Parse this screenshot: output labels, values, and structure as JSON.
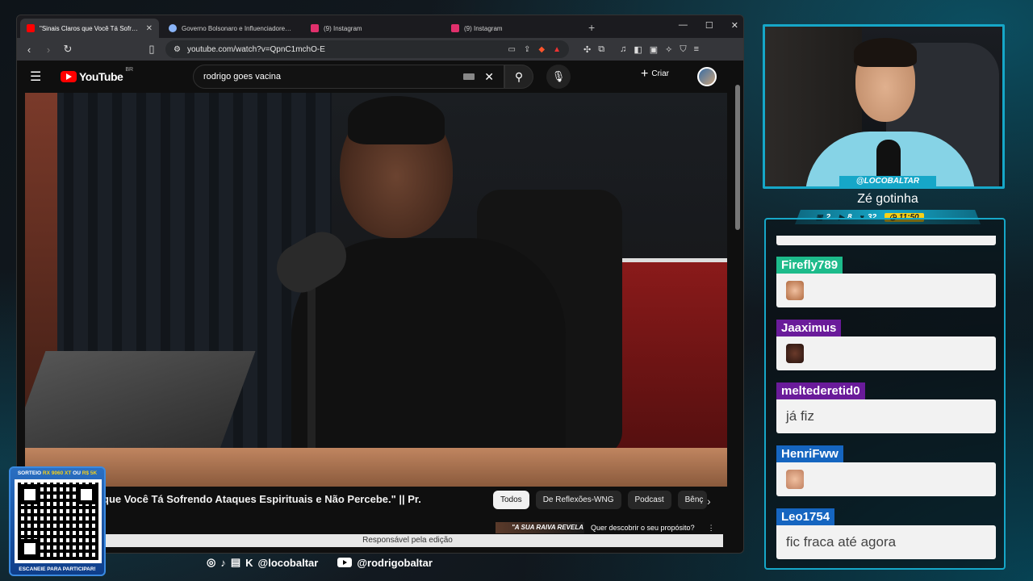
{
  "browser": {
    "tabs": [
      {
        "title": "\"Sinais Claros que Você Tá Sofrendo",
        "fav_color": "#ff0000",
        "active": true
      },
      {
        "title": "Governo Bolsonaro e Influenciadores Pagos",
        "fav_color": "#8ab4f8",
        "active": false
      },
      {
        "title": "(9) Instagram",
        "fav_color": "#e1306c",
        "active": false
      },
      {
        "title": "(9) Instagram",
        "fav_color": "#e1306c",
        "active": false
      }
    ],
    "url": "youtube.com/watch?v=QpnC1mchO-E"
  },
  "youtube": {
    "logo": "YouTube",
    "country": "BR",
    "search_value": "rodrigo goes vacina",
    "create_label": "Criar",
    "video_title": "que Você Tá Sofrendo Ataques Espirituais e Não Percebe.\" || Pr.",
    "chips": [
      "Todos",
      "De Reflexões-WNG",
      "Podcast",
      "Bênç"
    ],
    "rec_thumb_text": "\"A SUA RAIVA REVELA",
    "rec_title": "Quer descobrir o seu propósito?",
    "caption": "Responsável pela edição"
  },
  "stream": {
    "handle": "@LOCOBALTAR",
    "subtitle": "Zé gotinha",
    "stats": {
      "viewers": "2",
      "subs": "8",
      "follows": "32",
      "time": "11:50"
    },
    "accent": "#16a7c8",
    "time_color": "#f7d117"
  },
  "chat": [
    {
      "user": "Firefly789",
      "color": "#1dbb8b",
      "text": "",
      "emote": true
    },
    {
      "user": "Jaaximus",
      "color": "#6a1b9a",
      "text": "",
      "emote": true
    },
    {
      "user": "meltederetid0",
      "color": "#6a1b9a",
      "text": "já fiz",
      "emote": false
    },
    {
      "user": "HenriFww",
      "color": "#1565c0",
      "text": "",
      "emote": true
    },
    {
      "user": "Leo1754",
      "color": "#1565c0",
      "text": "fic fraca até agora",
      "emote": false
    }
  ],
  "qr": {
    "top_prefix": "SORTEIO",
    "top_highlight1": "RX 9060 XT",
    "top_mid": "OU",
    "top_highlight2": "R$ 5K",
    "bottom": "ESCANEIE PARA PARTICIPAR!"
  },
  "socials": {
    "handle1": "@locobaltar",
    "handle2": "@rodrigobaltar"
  }
}
